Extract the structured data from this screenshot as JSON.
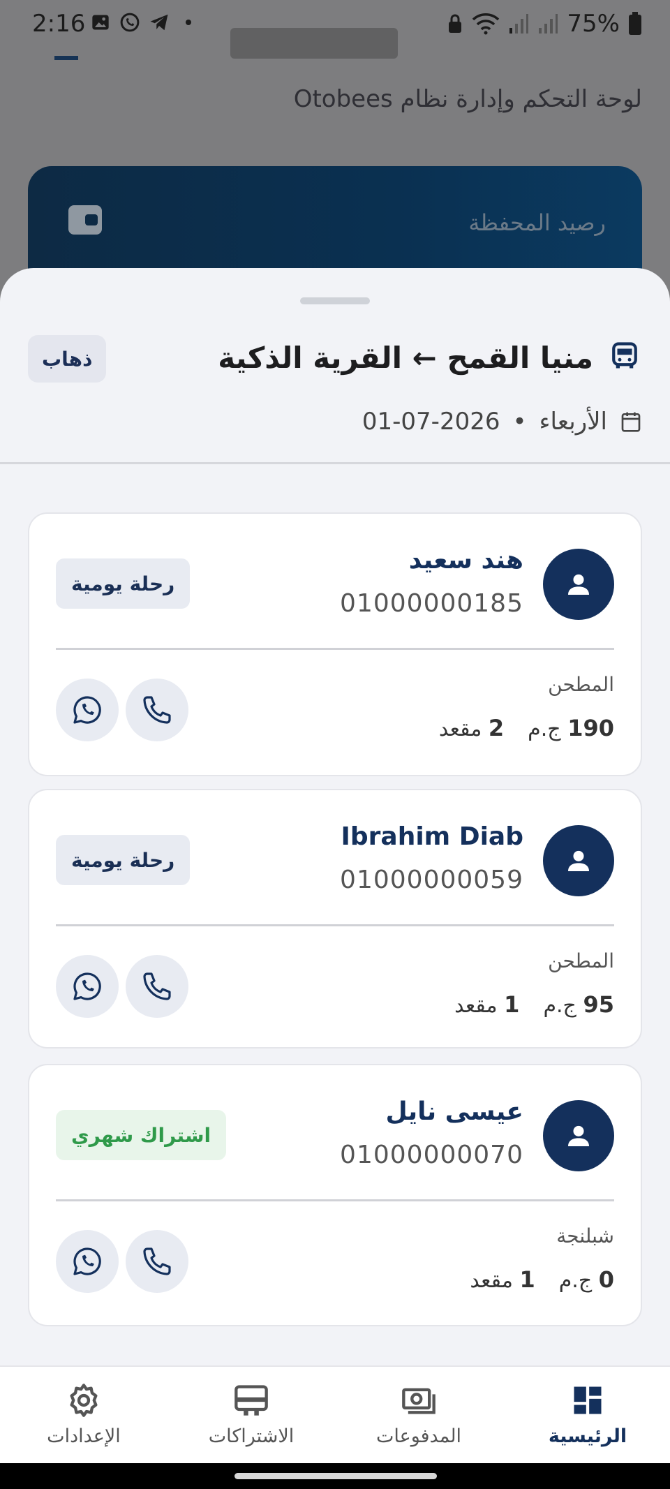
{
  "status_bar": {
    "time": "2:16",
    "battery_percent": "75%",
    "icons": [
      "image-icon",
      "whatsapp-icon",
      "telegram-icon",
      "dot-icon",
      "lock-icon",
      "wifi-icon",
      "signal-icon",
      "signal-icon-2",
      "battery-icon"
    ]
  },
  "background_screen": {
    "subtitle": "لوحة التحكم وإدارة نظام Otobees",
    "wallet_label": "رصيد المحفظة"
  },
  "sheet": {
    "route_title": "منيا القمح ← القرية الذكية",
    "direction_label": "ذهاب",
    "day": "الأربعاء",
    "separator": "•",
    "date": "01-07-2026"
  },
  "passengers": [
    {
      "name": "هند سعيد",
      "phone": "01000000185",
      "badge": "رحلة يومية",
      "stop": "المطحن",
      "seats": "2",
      "seats_label": "مقعد",
      "price": "190",
      "currency": "ج.م"
    },
    {
      "name": "Ibrahim Diab",
      "phone": "01000000059",
      "badge": "رحلة يومية",
      "stop": "المطحن",
      "seats": "1",
      "seats_label": "مقعد",
      "price": "95",
      "currency": "ج.م"
    },
    {
      "name": "عيسى نايل",
      "phone": "01000000070",
      "badge": "اشتراك شهري",
      "stop": "شبلنجة",
      "seats": "1",
      "seats_label": "مقعد",
      "price": "0",
      "currency": "ج.م"
    }
  ],
  "bottom_nav": {
    "home": "الرئيسية",
    "payments": "المدفوعات",
    "subscriptions": "الاشتراكات",
    "settings": "الإعدادات"
  },
  "colors": {
    "primary": "#14305c",
    "monthly_green": "#2f9a4a",
    "sheet_bg": "#f2f3f7",
    "wallet_card": "#0a3051"
  }
}
